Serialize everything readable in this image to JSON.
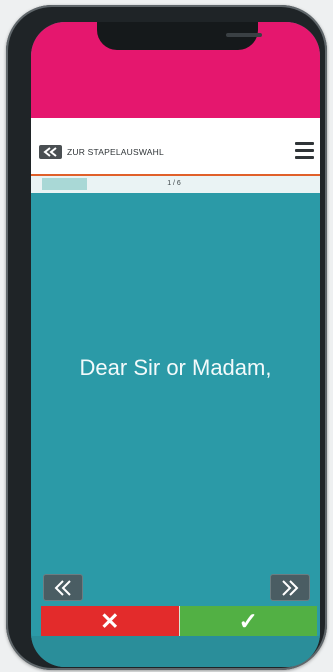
{
  "header": {
    "back_label": "ZUR STAPELAUSWAHL",
    "back_icon": "double-chevron-left-icon",
    "menu_icon": "hamburger-menu-icon"
  },
  "progress": {
    "label": "1 / 6",
    "current": 1,
    "total": 6,
    "fill_fraction": 0.17
  },
  "card": {
    "text": "Dear Sir or Madam,"
  },
  "navigation": {
    "prev_icon": "double-chevron-left-icon",
    "next_icon": "double-chevron-right-icon"
  },
  "answers": {
    "wrong_symbol": "✕",
    "right_symbol": "✓"
  },
  "colors": {
    "accent_pink": "#e5176e",
    "card_teal": "#2b9aa7",
    "wrong_red": "#e32b2b",
    "right_green": "#52b044",
    "header_rule": "#e0602a"
  }
}
